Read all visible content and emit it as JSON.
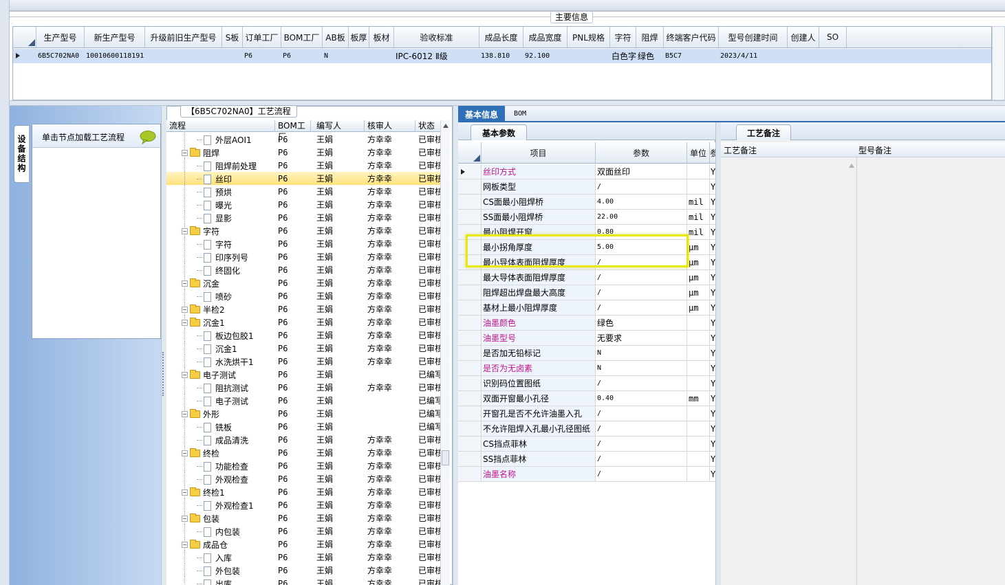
{
  "main_info": {
    "title": "主要信息",
    "columns": [
      "生产型号",
      "新生产型号",
      "升级前旧生产型号",
      "S板",
      "订单工厂",
      "BOM工厂",
      "AB板",
      "板厚",
      "板材",
      "验收标准",
      "成品长度",
      "成品宽度",
      "PNL规格",
      "字符",
      "阻焊",
      "终端客户代码",
      "型号创建时间",
      "创建人",
      "SO"
    ],
    "row": {
      "生产型号": "6B5C702NA0",
      "新生产型号": "10010600118191",
      "订单工厂": "P6",
      "BOM工厂": "P6",
      "AB板": "N",
      "验收标准": "IPC-6012 Ⅱ级",
      "成品长度": "138.810",
      "成品宽度": "92.100",
      "字符": "白色字符",
      "阻焊": "绿色",
      "终端客户代码": "B5C7",
      "型号创建时间": "2023/4/11"
    }
  },
  "left_panel": {
    "vertical_tab": "设备结构",
    "hint": "单击节点加载工艺流程",
    "chat_icon": "speech-bubble-icon"
  },
  "process_tree": {
    "title": "【6B5C702NA0】工艺流程",
    "columns": [
      "流程",
      "BOM工厂",
      "编写人",
      "核审人",
      "状态"
    ],
    "rows": [
      {
        "name": "外层AOI1",
        "level": 2,
        "folder": false,
        "bom": "P6",
        "writer": "王娟",
        "reviewer": "方幸幸",
        "status": "已审核"
      },
      {
        "name": "阻焊",
        "level": 1,
        "folder": true,
        "bom": "P6",
        "writer": "王娟",
        "reviewer": "方幸幸",
        "status": "已审核"
      },
      {
        "name": "阻焊前处理",
        "level": 2,
        "folder": false,
        "bom": "P6",
        "writer": "王娟",
        "reviewer": "方幸幸",
        "status": "已审核"
      },
      {
        "name": "丝印",
        "level": 2,
        "folder": false,
        "bom": "P6",
        "writer": "王娟",
        "reviewer": "方幸幸",
        "status": "已审核",
        "selected": true
      },
      {
        "name": "预烘",
        "level": 2,
        "folder": false,
        "bom": "P6",
        "writer": "王娟",
        "reviewer": "方幸幸",
        "status": "已审核"
      },
      {
        "name": "曝光",
        "level": 2,
        "folder": false,
        "bom": "P6",
        "writer": "王娟",
        "reviewer": "方幸幸",
        "status": "已审核"
      },
      {
        "name": "显影",
        "level": 2,
        "folder": false,
        "bom": "P6",
        "writer": "王娟",
        "reviewer": "方幸幸",
        "status": "已审核"
      },
      {
        "name": "字符",
        "level": 1,
        "folder": true,
        "bom": "P6",
        "writer": "王娟",
        "reviewer": "方幸幸",
        "status": "已审核"
      },
      {
        "name": "字符",
        "level": 2,
        "folder": false,
        "bom": "P6",
        "writer": "王娟",
        "reviewer": "方幸幸",
        "status": "已审核"
      },
      {
        "name": "印序列号",
        "level": 2,
        "folder": false,
        "bom": "P6",
        "writer": "王娟",
        "reviewer": "方幸幸",
        "status": "已审核"
      },
      {
        "name": "终固化",
        "level": 2,
        "folder": false,
        "bom": "P6",
        "writer": "王娟",
        "reviewer": "方幸幸",
        "status": "已审核"
      },
      {
        "name": "沉金",
        "level": 1,
        "folder": true,
        "bom": "P6",
        "writer": "王娟",
        "reviewer": "方幸幸",
        "status": "已审核"
      },
      {
        "name": "喷砂",
        "level": 2,
        "folder": false,
        "bom": "P6",
        "writer": "王娟",
        "reviewer": "方幸幸",
        "status": "已审核"
      },
      {
        "name": "半检2",
        "level": 1,
        "folder": true,
        "bom": "P6",
        "writer": "王娟",
        "reviewer": "方幸幸",
        "status": "已审核"
      },
      {
        "name": "沉金1",
        "level": 1,
        "folder": true,
        "bom": "P6",
        "writer": "王娟",
        "reviewer": "方幸幸",
        "status": "已审核"
      },
      {
        "name": "板边包胶1",
        "level": 2,
        "folder": false,
        "bom": "P6",
        "writer": "王娟",
        "reviewer": "方幸幸",
        "status": "已审核"
      },
      {
        "name": "沉金1",
        "level": 2,
        "folder": false,
        "bom": "P6",
        "writer": "王娟",
        "reviewer": "方幸幸",
        "status": "已审核"
      },
      {
        "name": "水洗烘干1",
        "level": 2,
        "folder": false,
        "bom": "P6",
        "writer": "王娟",
        "reviewer": "方幸幸",
        "status": "已审核"
      },
      {
        "name": "电子测试",
        "level": 1,
        "folder": true,
        "bom": "P6",
        "writer": "王娟",
        "reviewer": "",
        "status": "已编写"
      },
      {
        "name": "阻抗测试",
        "level": 2,
        "folder": false,
        "bom": "P6",
        "writer": "王娟",
        "reviewer": "方幸幸",
        "status": "已审核"
      },
      {
        "name": "电子测试",
        "level": 2,
        "folder": false,
        "bom": "P6",
        "writer": "王娟",
        "reviewer": "",
        "status": "已编写"
      },
      {
        "name": "外形",
        "level": 1,
        "folder": true,
        "bom": "P6",
        "writer": "王娟",
        "reviewer": "",
        "status": "已编写"
      },
      {
        "name": "铣板",
        "level": 2,
        "folder": false,
        "bom": "P6",
        "writer": "王娟",
        "reviewer": "",
        "status": "已编写"
      },
      {
        "name": "成品清洗",
        "level": 2,
        "folder": false,
        "bom": "P6",
        "writer": "王娟",
        "reviewer": "方幸幸",
        "status": "已审核"
      },
      {
        "name": "终检",
        "level": 1,
        "folder": true,
        "bom": "P6",
        "writer": "王娟",
        "reviewer": "方幸幸",
        "status": "已审核"
      },
      {
        "name": "功能检查",
        "level": 2,
        "folder": false,
        "bom": "P6",
        "writer": "王娟",
        "reviewer": "方幸幸",
        "status": "已审核"
      },
      {
        "name": "外观检查",
        "level": 2,
        "folder": false,
        "bom": "P6",
        "writer": "王娟",
        "reviewer": "方幸幸",
        "status": "已审核"
      },
      {
        "name": "终检1",
        "level": 1,
        "folder": true,
        "bom": "P6",
        "writer": "王娟",
        "reviewer": "方幸幸",
        "status": "已审核"
      },
      {
        "name": "外观检查1",
        "level": 2,
        "folder": false,
        "bom": "P6",
        "writer": "王娟",
        "reviewer": "方幸幸",
        "status": "已审核"
      },
      {
        "name": "包装",
        "level": 1,
        "folder": true,
        "bom": "P6",
        "writer": "王娟",
        "reviewer": "方幸幸",
        "status": "已审核"
      },
      {
        "name": "内包装",
        "level": 2,
        "folder": false,
        "bom": "P6",
        "writer": "王娟",
        "reviewer": "方幸幸",
        "status": "已审核"
      },
      {
        "name": "成品仓",
        "level": 1,
        "folder": true,
        "bom": "P6",
        "writer": "王娟",
        "reviewer": "方幸幸",
        "status": "已审核"
      },
      {
        "name": "入库",
        "level": 2,
        "folder": false,
        "bom": "P6",
        "writer": "王娟",
        "reviewer": "方幸幸",
        "status": "已审核"
      },
      {
        "name": "外包装",
        "level": 2,
        "folder": false,
        "bom": "P6",
        "writer": "王娟",
        "reviewer": "方幸幸",
        "status": "已审核"
      },
      {
        "name": "出库",
        "level": 2,
        "folder": false,
        "bom": "P6",
        "writer": "王娟",
        "reviewer": "方幸幸",
        "status": "已审核"
      }
    ]
  },
  "right_tabs": [
    "基本信息",
    "BOM"
  ],
  "params": {
    "subtab": "基本参数",
    "columns": [
      "项目",
      "参数",
      "单位",
      "参"
    ],
    "rows": [
      {
        "item": "丝印方式",
        "value": "双面丝印",
        "unit": "",
        "flag": "Y",
        "highlight": true,
        "current": true
      },
      {
        "item": "网板类型",
        "value": "/",
        "unit": "",
        "flag": "Y"
      },
      {
        "item": "CS面最小阻焊桥",
        "value": "4.00",
        "unit": "mil",
        "flag": "Y"
      },
      {
        "item": "SS面最小阻焊桥",
        "value": "22.00",
        "unit": "mil",
        "flag": "Y"
      },
      {
        "item": "最小阻焊开窗",
        "value": "0.80",
        "unit": "mil",
        "flag": "Y"
      },
      {
        "item": "最小拐角厚度",
        "value": "5.00",
        "unit": "μm",
        "flag": "Y"
      },
      {
        "item": "最小导体表面阻焊厚度",
        "value": "/",
        "unit": "μm",
        "flag": "Y"
      },
      {
        "item": "最大导体表面阻焊厚度",
        "value": "/",
        "unit": "μm",
        "flag": "Y"
      },
      {
        "item": "阻焊超出焊盘最大高度",
        "value": "/",
        "unit": "μm",
        "flag": "Y"
      },
      {
        "item": "基材上最小阻焊厚度",
        "value": "/",
        "unit": "μm",
        "flag": "Y"
      },
      {
        "item": "油墨颜色",
        "value": "绿色",
        "unit": "",
        "flag": "Y",
        "highlight": true
      },
      {
        "item": "油墨型号",
        "value": "无要求",
        "unit": "",
        "flag": "Y",
        "highlight": true
      },
      {
        "item": "是否加无铅标记",
        "value": "N",
        "unit": "",
        "flag": "Y"
      },
      {
        "item": "是否为无卤素",
        "value": "N",
        "unit": "",
        "flag": "Y",
        "highlight": true
      },
      {
        "item": "识别码位置图纸",
        "value": "/",
        "unit": "",
        "flag": "Y"
      },
      {
        "item": "双面开窗最小孔径",
        "value": "0.40",
        "unit": "mm",
        "flag": "Y"
      },
      {
        "item": "开窗孔是否不允许油墨入孔",
        "value": "/",
        "unit": "",
        "flag": "Y"
      },
      {
        "item": "不允许阻焊入孔最小孔径图纸",
        "value": "/",
        "unit": "",
        "flag": "Y"
      },
      {
        "item": "CS挡点菲林",
        "value": "/",
        "unit": "",
        "flag": "Y"
      },
      {
        "item": "SS挡点菲林",
        "value": "/",
        "unit": "",
        "flag": "Y"
      },
      {
        "item": "油墨名称",
        "value": "/",
        "unit": "",
        "flag": "Y",
        "highlight": true
      }
    ]
  },
  "remarks": {
    "tab": "工艺备注",
    "columns": [
      "工艺备注",
      "型号备注"
    ]
  },
  "colors": {
    "accent_blue": "#2f6fb6",
    "highlight_text": "#c0148c",
    "selection_row": "#ffe89a",
    "callout_box": "#e8e800"
  }
}
